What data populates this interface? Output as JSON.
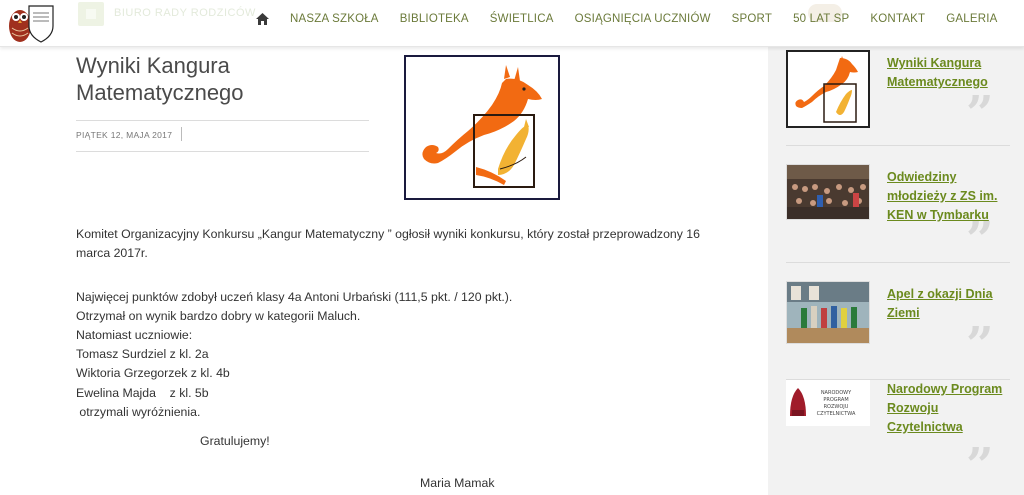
{
  "header": {
    "ghost_text": "BIURO RADY RODZICÓW",
    "nav": [
      "NASZA SZKOŁA",
      "BIBLIOTEKA",
      "ŚWIETLICA",
      "OSIĄGNIĘCIA UCZNIÓW",
      "SPORT",
      "50 LAT SP",
      "KONTAKT",
      "GALERIA"
    ]
  },
  "article": {
    "title": "Wyniki Kangura Matematycznego",
    "date": "PIĄTEK 12, MAJA 2017",
    "paragraph1": "Komitet Organizacyjny Konkursu „Kangur Matematyczny ” ogłosił wyniki konkursu, który został przeprowadzony 16 marca 2017r.",
    "lines": [
      "Najwięcej punktów zdobył uczeń klasy 4a Antoni Urbański (111,5 pkt. / 120 pkt.).",
      "Otrzymał on wynik bardzo dobry w kategorii Maluch.",
      "Natomiast uczniowie:",
      "Tomasz Surdziel  z kl. 2a",
      "Wiktoria Grzegorzek z kl. 4b",
      "Ewelina Majda    z kl. 5b",
      " otrzymali wyróżnienia."
    ],
    "congrats": "Gratulujemy!",
    "author": "Maria Mamak"
  },
  "sidebar": {
    "quote_glyph": "”",
    "cards": [
      {
        "title": "Wyniki Kangura Matematycznego",
        "thumb": "kangaroo-logo"
      },
      {
        "title": "Odwiedziny młodzieży z ZS im. KEN w Tymbarku",
        "thumb": "audience-photo"
      },
      {
        "title": "Apel z okazji Dnia Ziemi",
        "thumb": "gym-photo"
      },
      {
        "title": "Narodowy Program Rozwoju Czytelnictwa",
        "thumb": "npr-logo"
      }
    ],
    "npr_logo_text": [
      "NARODOWY",
      "PROGRAM",
      "ROZWOJU",
      "CZYTELNICTWA"
    ]
  },
  "colors": {
    "nav": "#6b7a3a",
    "link": "#6b8a1e",
    "sidebar_bg": "#f2f2f2",
    "kangaroo_orange": "#f26a12",
    "kangaroo_yellow": "#f2b233"
  }
}
